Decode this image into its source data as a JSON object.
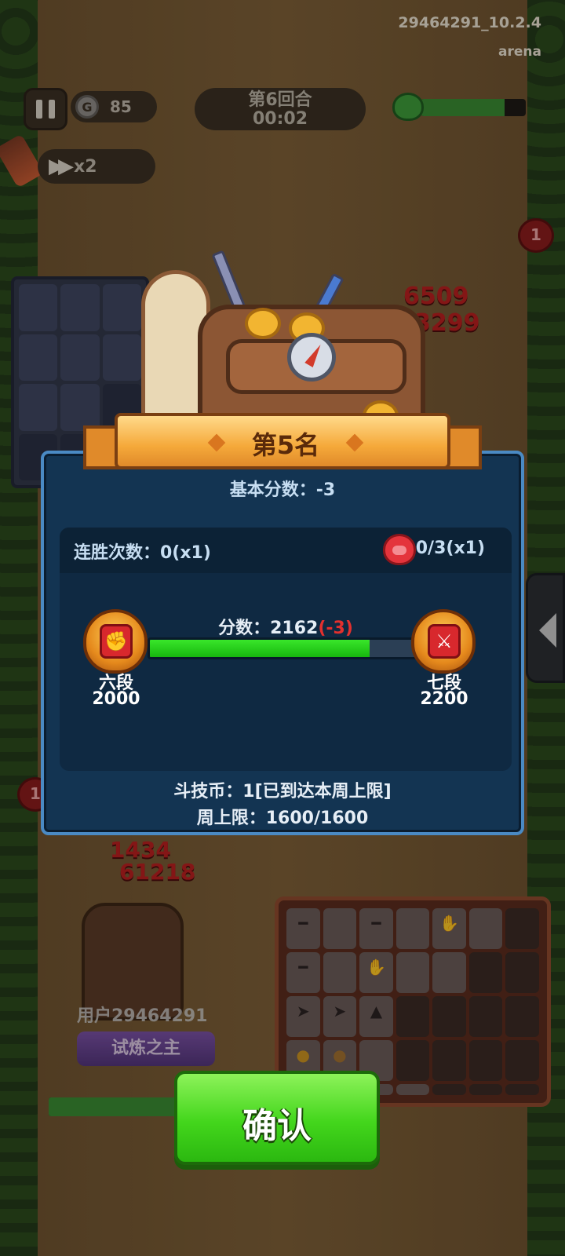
{
  "hud": {
    "version": "29464291_10.2.4",
    "mode": "arena",
    "coins": "85",
    "coin_symbol": "G",
    "round": "第6回合",
    "timer": "00:02",
    "speed": "x2",
    "hp_fraction": 0.8,
    "enemy_pig_count": "1",
    "player_pig_count": "1"
  },
  "scene": {
    "enemy_damage_1": "6509",
    "enemy_damage_2": "3299",
    "player_damage_1": "1434",
    "player_damage_2": "61218",
    "player_name": "用户29464291",
    "player_title": "试炼之主",
    "player_hp_fraction": 0.95
  },
  "result": {
    "rank_title": "第5名",
    "base_score": "基本分数：-3",
    "streak": "连胜次数：0(x1)",
    "pig_progress": "0/3(x1)",
    "score_label": "分数：2162",
    "score_delta": "(-3)",
    "score_progress": 0.81,
    "current_rank": {
      "name": "六段",
      "points": "2000",
      "glyph": "✊"
    },
    "next_rank": {
      "name": "七段",
      "points": "2200",
      "glyph": "⚔"
    },
    "arena_coins": "斗技币：1[已到达本周上限]",
    "weekly_limit": "周上限：1600/1600",
    "confirm_label": "确认"
  },
  "colors": {
    "panel": "#133452",
    "panel_border": "#4a8ac4",
    "progress_green": "#2ad61c",
    "confirm_green": "#43d61c",
    "delta_red": "#e3302e"
  }
}
